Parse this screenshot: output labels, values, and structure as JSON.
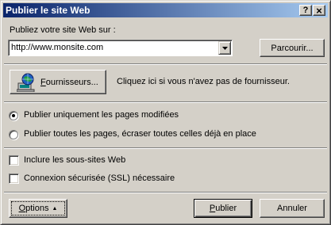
{
  "window": {
    "title": "Publier le site Web",
    "help_label": "?",
    "close_label": "×"
  },
  "url_section": {
    "label": "Publiez votre site Web sur :",
    "url_value": "http://www.monsite.com",
    "browse_label": "Parcourir..."
  },
  "provider": {
    "button_label": "Fournisseurs...",
    "hint": "Cliquez ici si vous n'avez pas de fournisseur.",
    "icon": "globe-computer-icon"
  },
  "publish_options": [
    {
      "label": "Publier uniquement les pages modifiées",
      "checked": true
    },
    {
      "label": "Publier toutes les pages, écraser toutes celles déjà en place",
      "checked": false
    }
  ],
  "extra_options": [
    {
      "label": "Inclure les sous-sites Web",
      "checked": false
    },
    {
      "label": "Connexion sécurisée (SSL) nécessaire",
      "checked": false
    }
  ],
  "footer": {
    "options_label": "Options",
    "options_arrow": "▲",
    "publish_label": "Publier",
    "cancel_label": "Annuler"
  }
}
